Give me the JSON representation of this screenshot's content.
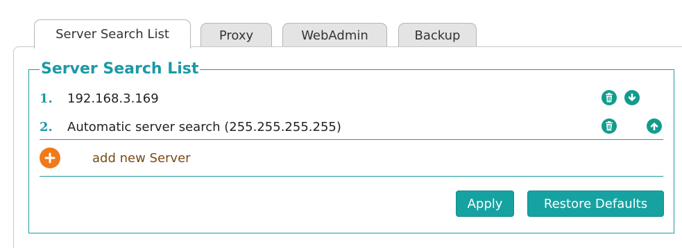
{
  "tabs": [
    {
      "label": "Server Search List",
      "active": true
    },
    {
      "label": "Proxy",
      "active": false
    },
    {
      "label": "WebAdmin",
      "active": false
    },
    {
      "label": "Backup",
      "active": false
    }
  ],
  "section": {
    "legend": "Server Search List"
  },
  "servers": [
    {
      "number": "1.",
      "address": "192.168.3.169",
      "actions": [
        "trash-icon",
        "arrow-down-icon"
      ]
    },
    {
      "number": "2.",
      "address": "Automatic server search (255.255.255.255)",
      "actions": [
        "trash-icon",
        "arrow-up-icon"
      ]
    }
  ],
  "add_server": {
    "label": "add new Server",
    "icon": "plus-icon"
  },
  "buttons": {
    "apply": "Apply",
    "restore_defaults": "Restore Defaults"
  },
  "colors": {
    "accent": "#1a9aa6",
    "button": "#17a2a2",
    "icon_teal": "#119c8c",
    "add_orange": "#f07a1a",
    "add_label": "#7a4a12"
  }
}
